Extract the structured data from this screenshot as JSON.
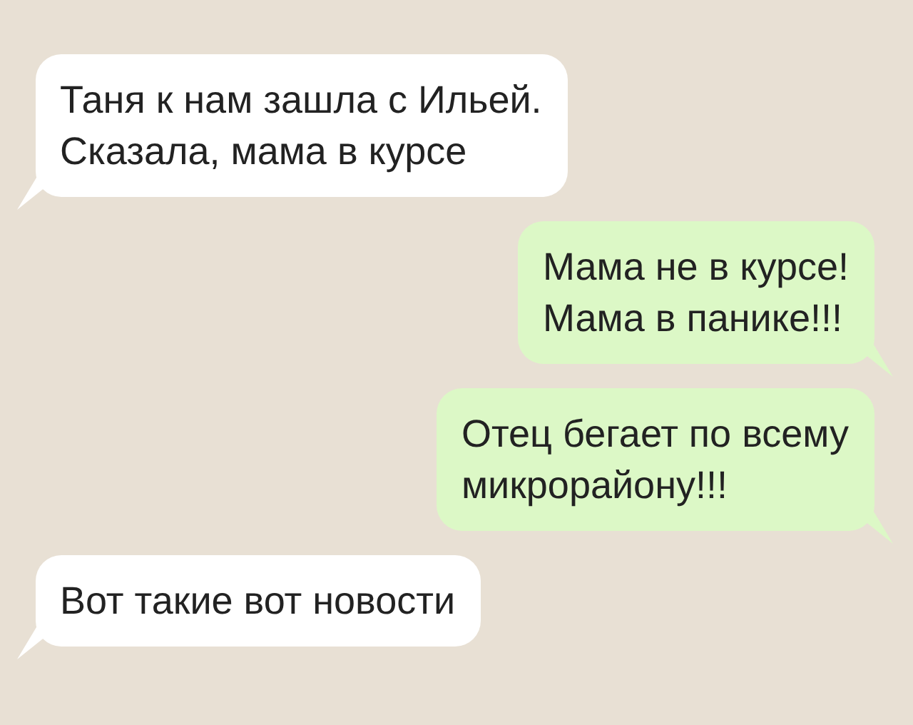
{
  "messages": [
    {
      "kind": "incoming",
      "text": "Таня к нам зашла с Ильей.\nСказала, мама в курсе"
    },
    {
      "kind": "outgoing",
      "text": "Мама не в курсе!\nМама в панике!!!"
    },
    {
      "kind": "outgoing",
      "text": "Отец бегает по всему\nмикрорайону!!!"
    },
    {
      "kind": "incoming",
      "text": "Вот такие вот новости"
    }
  ]
}
